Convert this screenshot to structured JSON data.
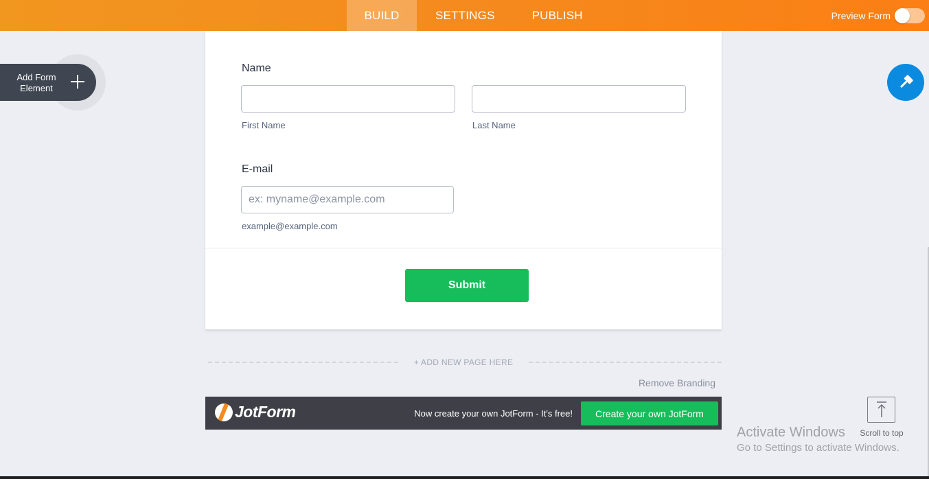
{
  "topbar": {
    "tabs": [
      {
        "label": "BUILD",
        "active": true
      },
      {
        "label": "SETTINGS",
        "active": false
      },
      {
        "label": "PUBLISH",
        "active": false
      }
    ],
    "preview_label": "Preview Form",
    "preview_enabled": false
  },
  "sidebar": {
    "add_element_label": "Add Form Element",
    "add_icon": "plus-icon"
  },
  "designer": {
    "icon": "paint-roller-icon"
  },
  "form": {
    "name": {
      "label": "Name",
      "first_value": "",
      "last_value": "",
      "first_sublabel": "First Name",
      "last_sublabel": "Last Name"
    },
    "email": {
      "label": "E-mail",
      "placeholder": "ex: myname@example.com",
      "sublabel": "example@example.com"
    },
    "submit_label": "Submit"
  },
  "add_page_label": "+ ADD NEW PAGE HERE",
  "remove_branding_label": "Remove Branding",
  "branding": {
    "logo_text": "JotForm",
    "tagline": "Now create your own JotForm - It's free!",
    "cta_label": "Create your own JotForm"
  },
  "scroll_top_label": "Scroll to top",
  "watermark": {
    "title": "Activate Windows",
    "subtitle": "Go to Settings to activate Windows."
  },
  "colors": {
    "accent_orange": "#f58a1e",
    "submit_green": "#18bd5b",
    "designer_blue": "#0a8be0",
    "dark_panel": "#3f4651"
  }
}
